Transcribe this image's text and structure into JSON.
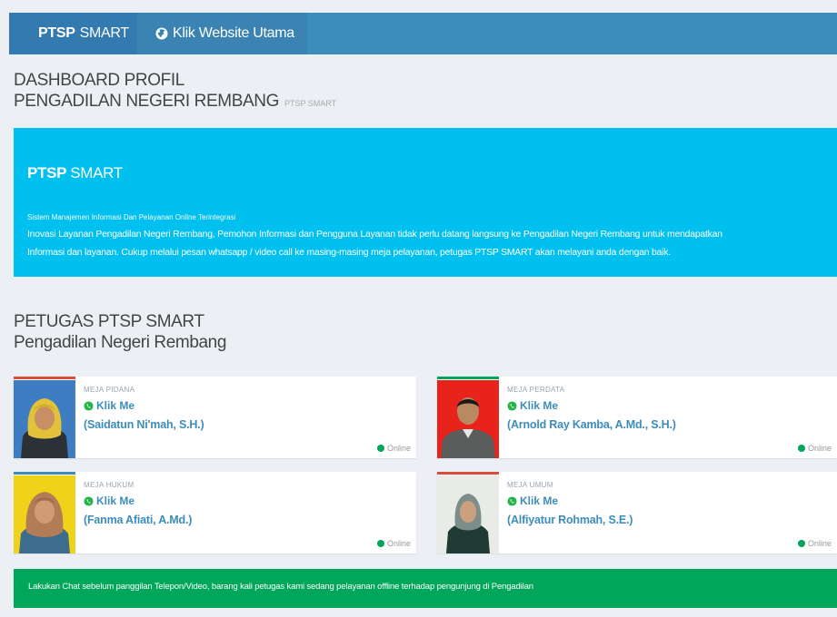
{
  "nav": {
    "brand_bold": "PTSP",
    "brand_rest": "SMART",
    "website_link": "Klik Website Utama"
  },
  "page": {
    "title_line1": "DASHBOARD PROFIL",
    "title_line2": "PENGADILAN NEGERI REMBANG",
    "title_small": "PTSP SMART"
  },
  "callout": {
    "title_bold": "PTSP",
    "title_rest": "SMART",
    "subtitle": "Sistem Manajemen Informasi Dan Pelayanan Online Terintegrasi",
    "text_line1": "Inovasi Layanan Pengadilan Negeri Rembang, Pemohon Informasi dan Pengguna Layanan tidak perlu datang langsung ke Pengadilan Negeri Rembang untuk mendapatkan",
    "text_line2": "Informasi dan layanan. Cukup melalui pesan whatsapp / video call ke masing-masing meja pelayanan, petugas PTSP SMART akan melayani anda dengan baik."
  },
  "section": {
    "title_line1": "PETUGAS PTSP SMART",
    "title_line2": "Pengadilan Negeri Rembang"
  },
  "cards": [
    {
      "label": "MEJA PIDANA",
      "klik": "Klik Me",
      "name": "(Saidatun Ni'mah, S.H.)",
      "status": "Online",
      "accent": "#dd4b39"
    },
    {
      "label": "MEJA PERDATA",
      "klik": "Klik Me",
      "name": "(Arnold Ray Kamba, A.Md., S.H.)",
      "status": "Online",
      "accent": "#00a65a"
    },
    {
      "label": "MEJA HUKUM",
      "klik": "Klik Me",
      "name": "(Fanma Afiati, A.Md.)",
      "status": "Online",
      "accent": "#3c8dbc"
    },
    {
      "label": "MEJA UMUM",
      "klik": "Klik Me",
      "name": "(Alfiyatur Rohmah, S.E.)",
      "status": "Online",
      "accent": "#dd4b39"
    }
  ],
  "notice": "Lakukan Chat sebelum panggilan Telepon/Video, barang kali petugas kami sedang pelayanan offline terhadap pengunjung di Pengadilan",
  "colors": {
    "nav": "#3c8dbc",
    "info": "#00c0ef",
    "success": "#00a65a",
    "link": "#3c8dbc"
  }
}
